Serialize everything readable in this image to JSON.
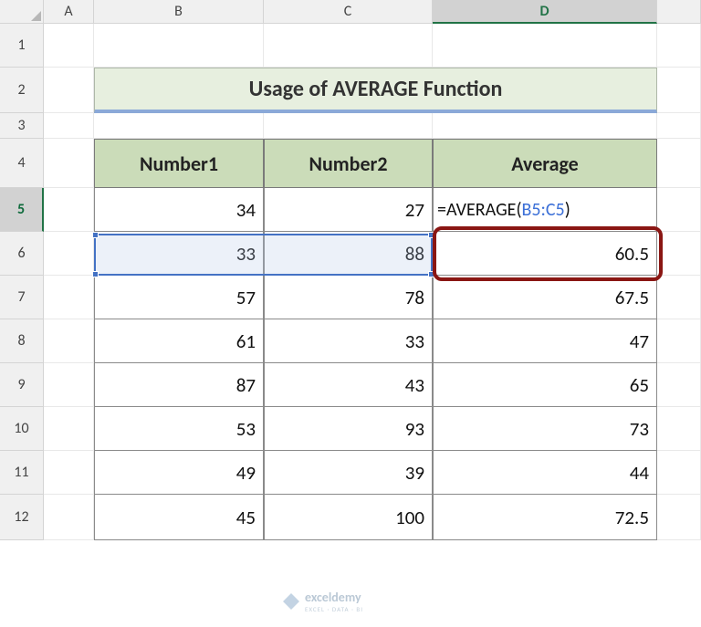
{
  "columns": [
    "A",
    "B",
    "C",
    "D",
    ""
  ],
  "rows": [
    "1",
    "2",
    "3",
    "4",
    "5",
    "6",
    "7",
    "8",
    "9",
    "10",
    "11",
    "12"
  ],
  "activeColumn": "D",
  "activeRow": "5",
  "title": "Usage of AVERAGE Function",
  "headers": {
    "b": "Number1",
    "c": "Number2",
    "d": "Average"
  },
  "formula": {
    "prefix": "=AVERAGE(",
    "ref": "B5:C5",
    "suffix": ")"
  },
  "data": [
    {
      "b": "34",
      "c": "27",
      "d_formula": true
    },
    {
      "b": "33",
      "c": "88",
      "d": "60.5"
    },
    {
      "b": "57",
      "c": "78",
      "d": "67.5"
    },
    {
      "b": "61",
      "c": "33",
      "d": "47"
    },
    {
      "b": "87",
      "c": "43",
      "d": "65"
    },
    {
      "b": "53",
      "c": "93",
      "d": "73"
    },
    {
      "b": "49",
      "c": "39",
      "d": "44"
    },
    {
      "b": "45",
      "c": "100",
      "d": "72.5"
    }
  ],
  "watermark": {
    "brand": "exceldemy",
    "sub": "EXCEL · DATA · BI"
  },
  "chart_data": {
    "type": "table",
    "title": "Usage of AVERAGE Function",
    "columns": [
      "Number1",
      "Number2",
      "Average"
    ],
    "rows": [
      [
        34,
        27,
        "=AVERAGE(B5:C5)"
      ],
      [
        33,
        88,
        60.5
      ],
      [
        57,
        78,
        67.5
      ],
      [
        61,
        33,
        47
      ],
      [
        87,
        43,
        65
      ],
      [
        53,
        93,
        73
      ],
      [
        49,
        39,
        44
      ],
      [
        45,
        100,
        72.5
      ]
    ]
  }
}
